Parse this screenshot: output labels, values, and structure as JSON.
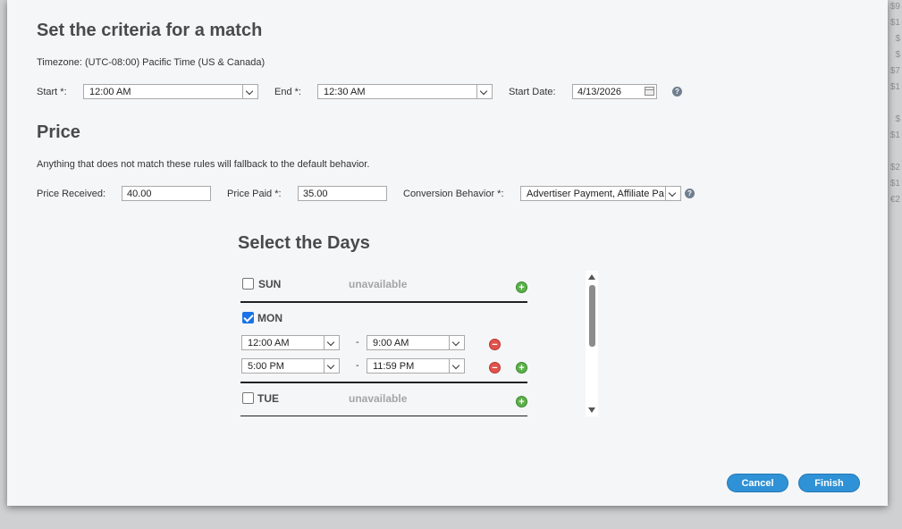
{
  "background_column": [
    "$9",
    "$1",
    "$",
    "$",
    "$7",
    "$1",
    "$",
    "$1",
    "$2",
    "$1",
    "€2"
  ],
  "criteria": {
    "title": "Set the criteria for a match",
    "timezone": "Timezone: (UTC-08:00) Pacific Time (US & Canada)",
    "start_label": "Start *:",
    "start_value": "12:00 AM",
    "end_label": "End *:",
    "end_value": "12:30 AM",
    "start_date_label": "Start Date:",
    "start_date_value": "4/13/2026"
  },
  "price": {
    "title": "Price",
    "note": "Anything that does not match these rules will fallback to the default behavior.",
    "received_label": "Price Received:",
    "received_value": "40.00",
    "paid_label": "Price Paid *:",
    "paid_value": "35.00",
    "conversion_label": "Conversion Behavior *:",
    "conversion_value": "Advertiser Payment, Affiliate Pa"
  },
  "days": {
    "title": "Select the Days",
    "unavailable_label": "unavailable",
    "sun": {
      "label": "SUN",
      "checked": false
    },
    "mon": {
      "label": "MON",
      "checked": true,
      "ranges": [
        {
          "from": "12:00 AM",
          "to": "9:00 AM"
        },
        {
          "from": "5:00 PM",
          "to": "11:59 PM"
        }
      ]
    },
    "tue": {
      "label": "TUE",
      "checked": false
    },
    "range_separator": "-"
  },
  "actions": {
    "cancel": "Cancel",
    "finish": "Finish"
  },
  "icons": {
    "help": "?",
    "add": "+",
    "remove": "−"
  },
  "colors": {
    "button": "#2f91d6",
    "add": "#5cb14a",
    "remove": "#e0524b",
    "checkbox": "#1a73e8"
  }
}
